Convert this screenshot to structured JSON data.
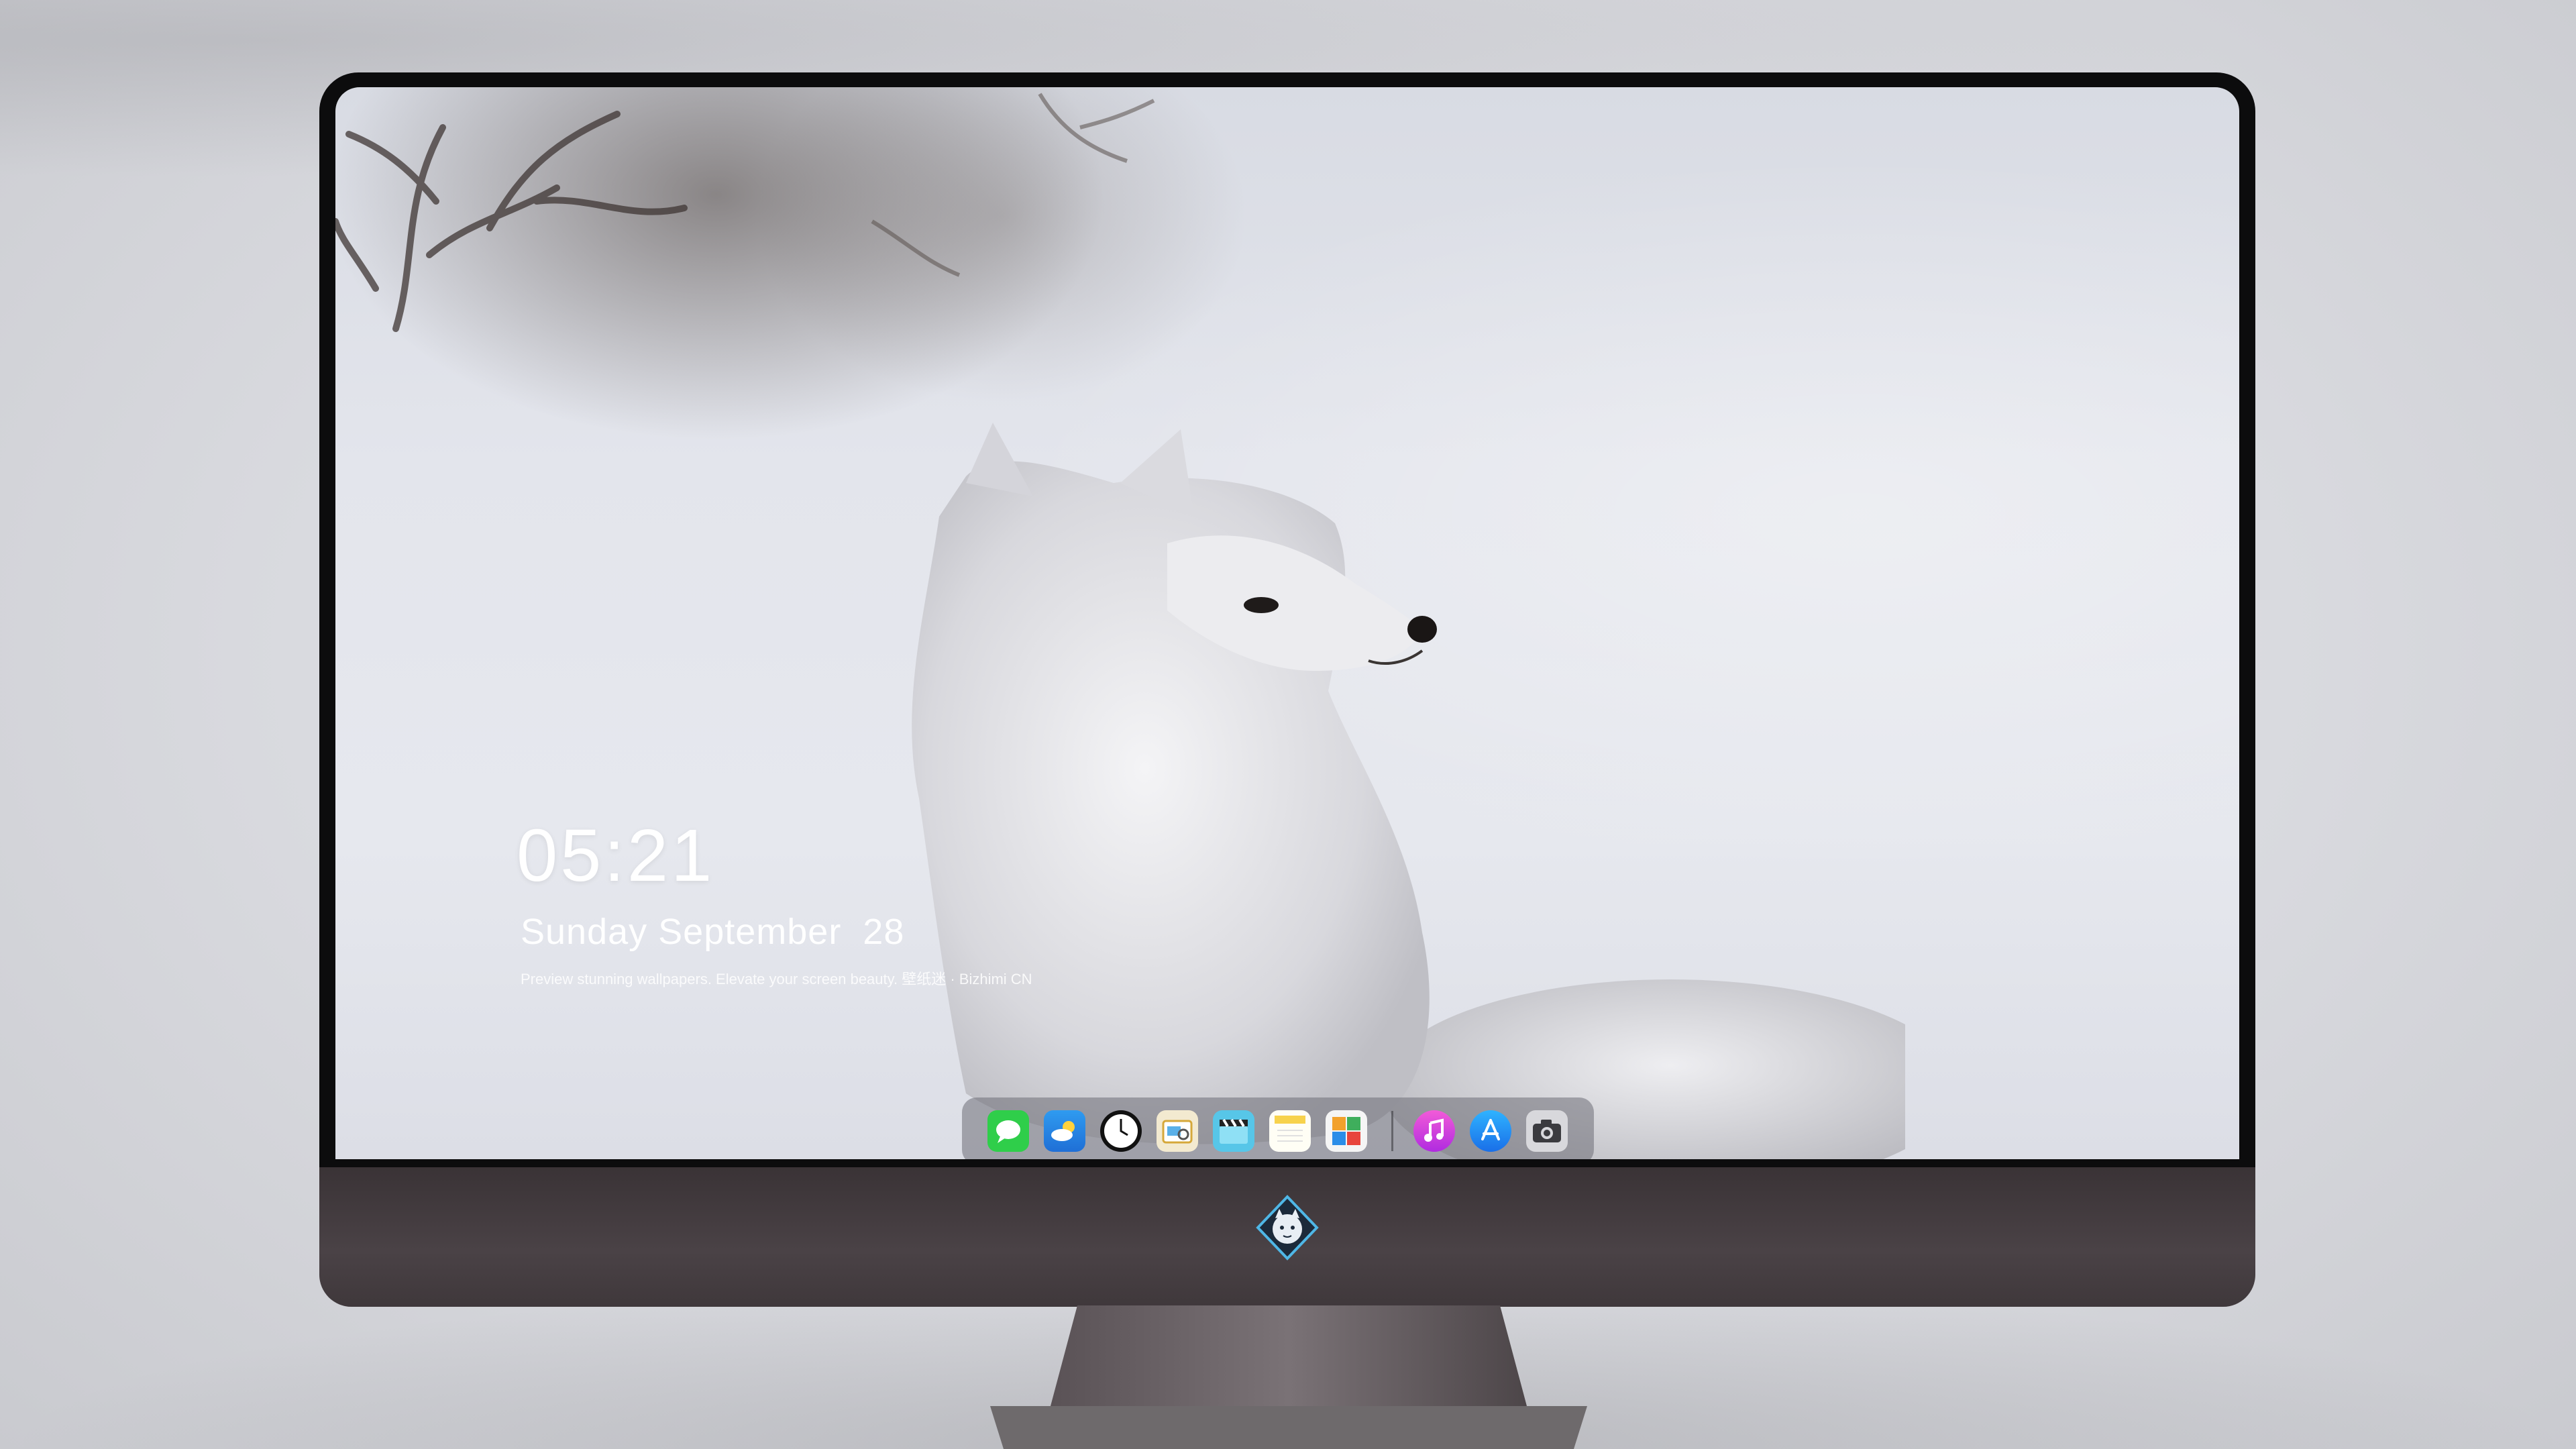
{
  "lock_screen": {
    "time": "05:21",
    "date": "Sunday September  28",
    "caption": "Preview stunning wallpapers. Elevate your screen beauty. 壁纸迷 · Bizhimi CN"
  },
  "dock": {
    "apps": [
      {
        "name": "Messages",
        "icon": "messages-icon",
        "color": "#2fce4a"
      },
      {
        "name": "Weather",
        "icon": "weather-icon",
        "color": "#2b8de8"
      },
      {
        "name": "Clock",
        "icon": "clock-icon",
        "color": "#111111"
      },
      {
        "name": "Preview",
        "icon": "preview-icon",
        "color": "#e8c35a"
      },
      {
        "name": "Clips",
        "icon": "clapperboard-icon",
        "color": "#57c6e8"
      },
      {
        "name": "Notes",
        "icon": "notes-icon",
        "color": "#f7d24c"
      },
      {
        "name": "Photo Booth",
        "icon": "photo-grid-icon",
        "color": "#3fae5c"
      },
      {
        "name": "Music",
        "icon": "music-icon",
        "color": "#d440e0"
      },
      {
        "name": "App Store",
        "icon": "app-store-icon",
        "color": "#1f8cf0"
      },
      {
        "name": "Camera",
        "icon": "camera-icon",
        "color": "#4a4a4e"
      }
    ]
  },
  "branding": {
    "logo": "fox-mascot-logo"
  }
}
